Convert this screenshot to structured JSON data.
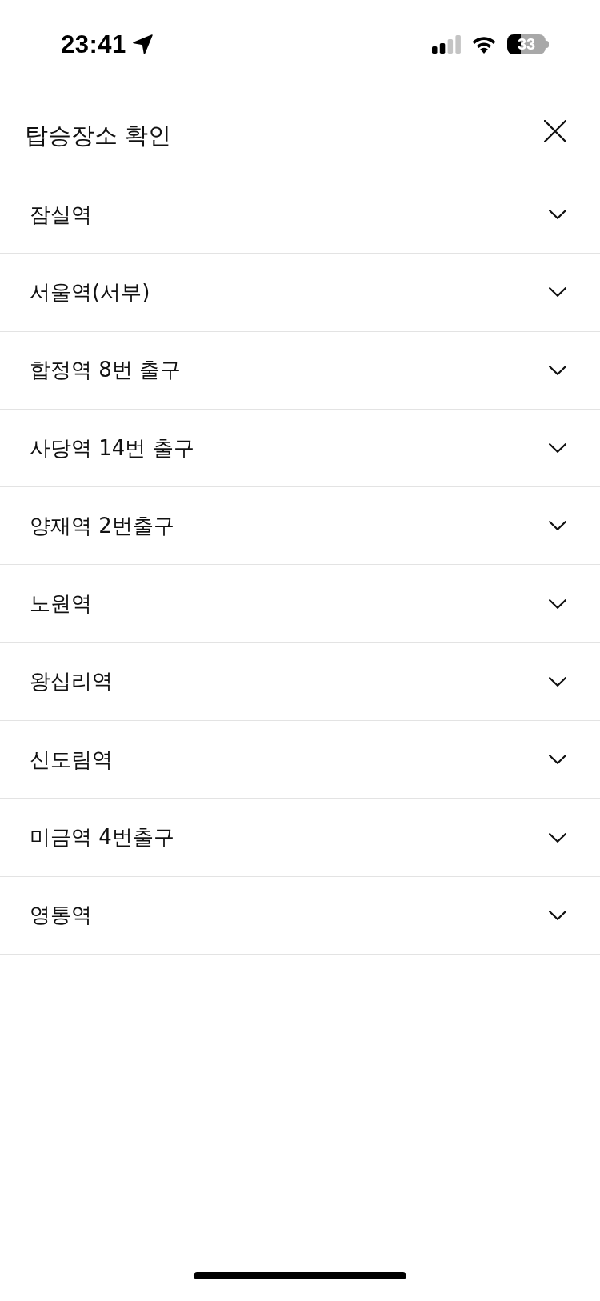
{
  "status_bar": {
    "time": "23:41",
    "battery": "33"
  },
  "header": {
    "title": "탑승장소 확인"
  },
  "locations": [
    {
      "name": "잠실역",
      "expanded": false
    },
    {
      "name": "서울역(서부)",
      "expanded": false
    },
    {
      "name": "합정역 8번 출구",
      "expanded": false
    },
    {
      "name": "사당역 14번 출구",
      "expanded": false
    },
    {
      "name": "양재역 2번출구",
      "expanded": false
    },
    {
      "name": "노원역",
      "expanded": false
    },
    {
      "name": "왕십리역",
      "expanded": false
    },
    {
      "name": "신도림역",
      "expanded": false
    },
    {
      "name": "미금역 4번출구",
      "expanded": false
    },
    {
      "name": "영통역",
      "expanded": false
    }
  ]
}
